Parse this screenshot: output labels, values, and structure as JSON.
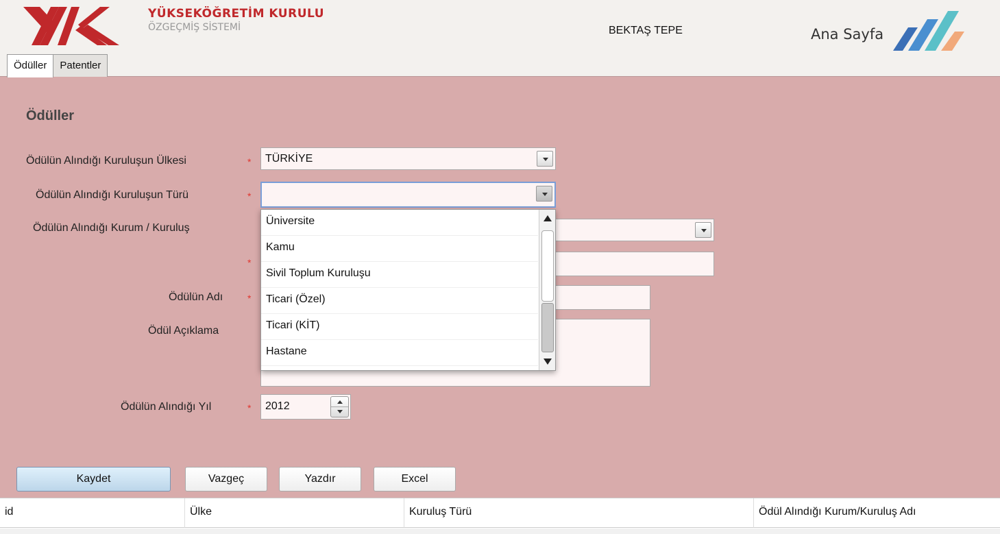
{
  "header": {
    "brand_title": "YÜKSEKÖĞRETİM KURULU",
    "brand_subtitle": "ÖZGEÇMİŞ SİSTEMİ",
    "user_name": "BEKTAŞ TEPE",
    "home_link": "Ana Sayfa"
  },
  "tabs": [
    {
      "label": "Ödüller",
      "active": true
    },
    {
      "label": "Patentler",
      "active": false
    }
  ],
  "page_title": "Ödüller",
  "form": {
    "country_label": "Ödülün Alındığı Kuruluşun Ülkesi",
    "country_value": "TÜRKİYE",
    "type_label": "Ödülün Alındığı Kuruluşun Türü",
    "type_value": "",
    "institution_label": "Ödülün Alındığı Kurum / Kuruluş",
    "award_name_label": "Ödülün Adı",
    "description_label": "Ödül Açıklama",
    "year_label": "Ödülün Alındığı Yıl",
    "year_value": "2012",
    "required_mark": "*"
  },
  "dropdown_options": [
    "Üniversite",
    "Kamu",
    "Sivil Toplum Kuruluşu",
    "Ticari (Özel)",
    "Ticari (KİT)",
    "Hastane"
  ],
  "buttons": {
    "save": "Kaydet",
    "cancel": "Vazgeç",
    "print": "Yazdır",
    "excel": "Excel"
  },
  "grid": {
    "columns": [
      "id",
      "Ülke",
      "Kuruluş Türü",
      "Ödül Alındığı Kurum/Kuruluş Adı"
    ]
  },
  "colors": {
    "background": "#d8abab",
    "brand_red": "#c0282b",
    "required": "#e0362f"
  }
}
